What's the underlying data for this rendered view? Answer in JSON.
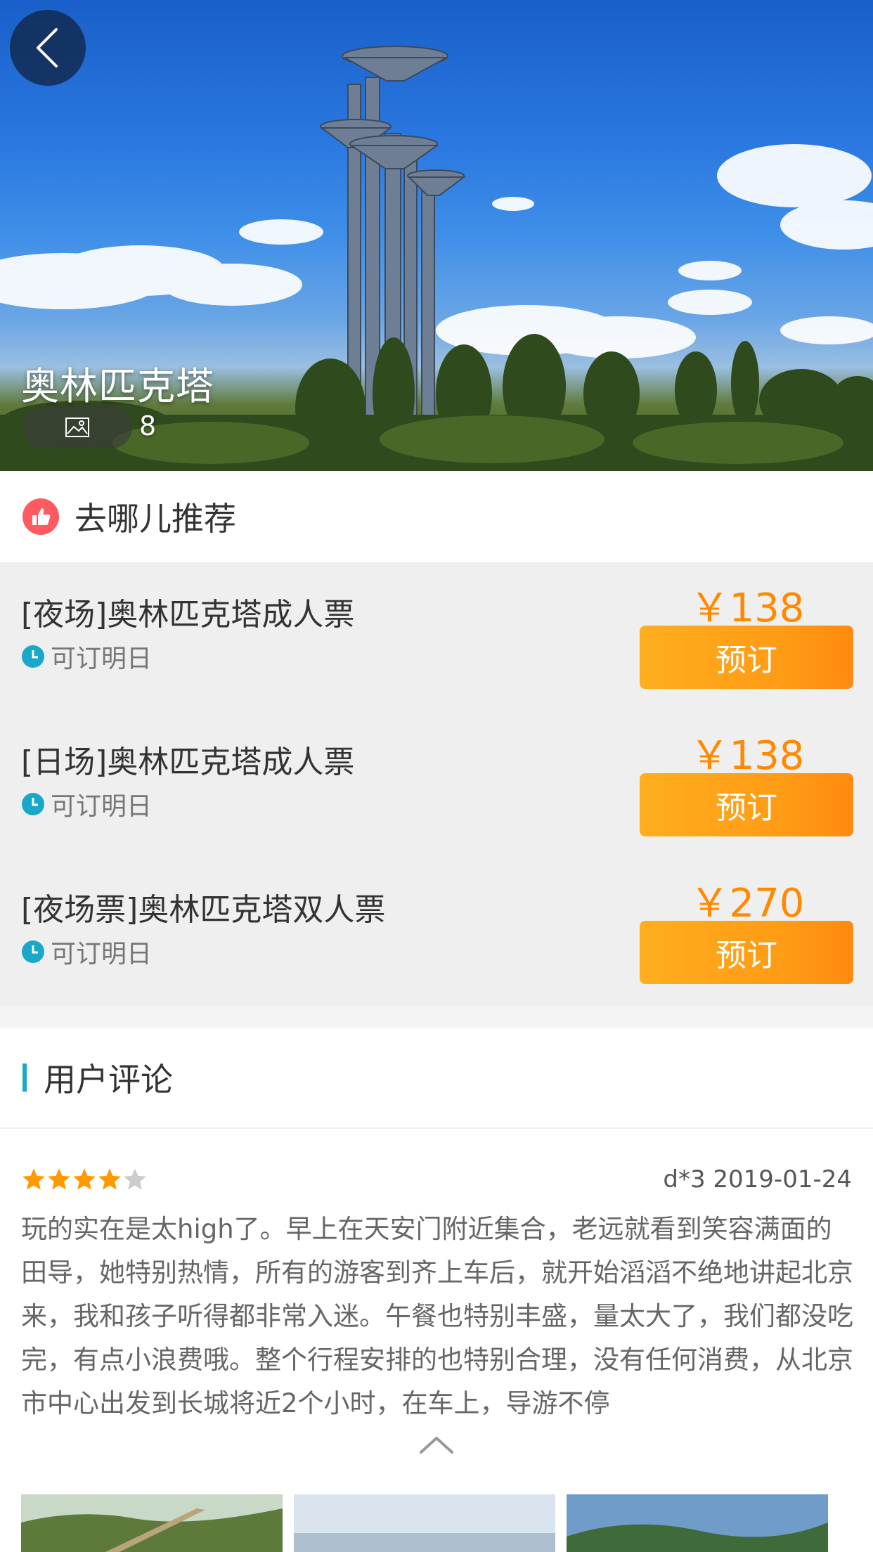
{
  "hero": {
    "title": "奥林匹克塔",
    "photo_count": "8"
  },
  "recommend": {
    "title": "去哪儿推荐",
    "tickets": [
      {
        "name": "[夜场]奥林匹克塔成人票",
        "availability": "可订明日",
        "price": "￥138",
        "button": "预订"
      },
      {
        "name": "[日场]奥林匹克塔成人票",
        "availability": "可订明日",
        "price": "￥138",
        "button": "预订"
      },
      {
        "name": "[夜场票]奥林匹克塔双人票",
        "availability": "可订明日",
        "price": "￥270",
        "button": "预订"
      }
    ]
  },
  "comments": {
    "title": "用户评论",
    "review": {
      "rating": 4,
      "rating_max": 5,
      "user_date": "d*3 2019-01-24",
      "text": "玩的实在是太high了。早上在天安门附近集合，老远就看到笑容满面的田导，她特别热情，所有的游客到齐上车后，就开始滔滔不绝地讲起北京来，我和孩子听得都非常入迷。午餐也特别丰盛，量太大了，我们都没吃完，有点小浪费哦。整个行程安排的也特别合理，没有任何消费，从北京市中心出发到长城将近2个小时，在车上，导游不停"
    }
  },
  "colors": {
    "accent_orange": "#ff8a00",
    "button_orange": "#ff9a14",
    "teal": "#1aa8c8",
    "like_red": "#ff5a5f",
    "star_gold": "#ff9900",
    "star_gray": "#cccccc"
  },
  "icons": [
    "back-arrow-icon",
    "image-icon",
    "thumbs-up-icon",
    "clock-icon",
    "star-icon",
    "chevron-up-icon"
  ]
}
